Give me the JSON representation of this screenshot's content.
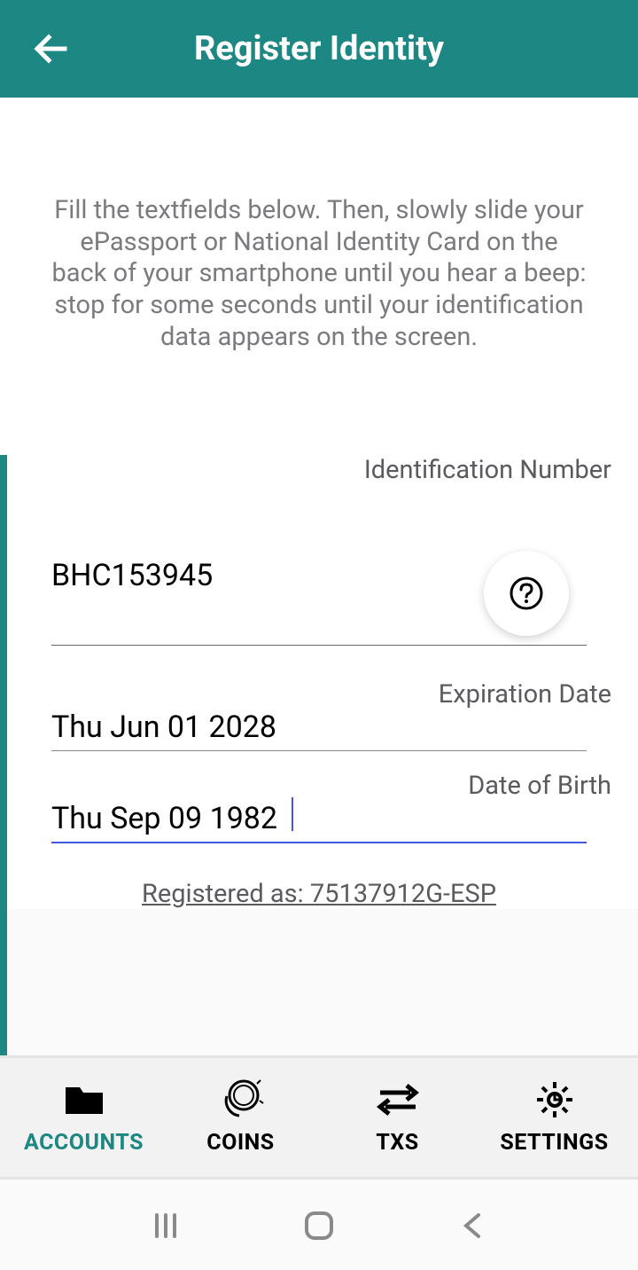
{
  "header": {
    "title": "Register Identity"
  },
  "instructions": "Fill the textfields below. Then, slowly slide your ePassport or National Identity Card on the back of your smartphone until you hear a beep: stop for some seconds until your identification data appears on the screen.",
  "fields": {
    "id_label": "Identification Number",
    "id_value": "BHC153945",
    "exp_label": "Expiration Date",
    "exp_value": "Thu Jun 01 2028",
    "dob_label": "Date of Birth",
    "dob_value": "Thu Sep 09 1982"
  },
  "registered": "Registered as: 75137912G-ESP",
  "tabs": {
    "accounts": "ACCOUNTS",
    "coins": "COINS",
    "txs": "TXS",
    "settings": "SETTINGS"
  }
}
